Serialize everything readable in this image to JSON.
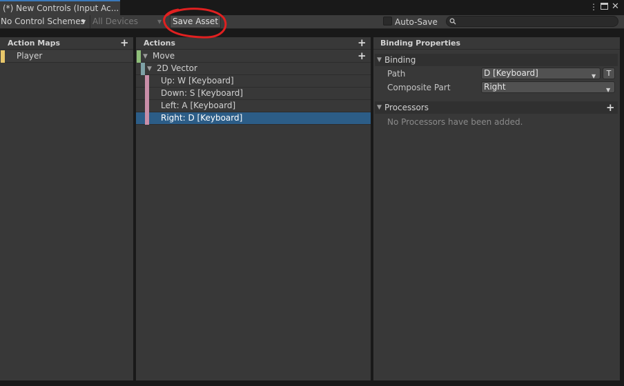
{
  "window": {
    "tab_title": "(*) New Controls (Input Ac...",
    "menu_icon": "kebab-menu-icon",
    "maximize_icon": "maximize-icon",
    "close_icon": "close-icon"
  },
  "toolbar": {
    "control_scheme": "No Control Schemes",
    "devices": "All Devices",
    "save_label": "Save Asset",
    "autosave_label": "Auto-Save",
    "autosave_checked": false,
    "search_placeholder": ""
  },
  "action_maps": {
    "header": "Action Maps",
    "items": [
      {
        "label": "Player",
        "color": "#e8c76a"
      }
    ]
  },
  "actions": {
    "header": "Actions",
    "rows": [
      {
        "label": "Move",
        "color": "#8fbf7a",
        "level": 0,
        "expanded": true,
        "selected": false
      },
      {
        "label": "2D Vector",
        "color": "#7ea1a6",
        "level": 1,
        "expanded": true,
        "selected": false
      },
      {
        "label": "Up: W [Keyboard]",
        "color": "#c98ea8",
        "level": 2,
        "selected": false
      },
      {
        "label": "Down: S [Keyboard]",
        "color": "#c98ea8",
        "level": 2,
        "selected": false
      },
      {
        "label": "Left: A [Keyboard]",
        "color": "#c98ea8",
        "level": 2,
        "selected": false
      },
      {
        "label": "Right: D [Keyboard]",
        "color": "#c98ea8",
        "level": 2,
        "selected": true
      }
    ]
  },
  "binding_properties": {
    "header": "Binding Properties",
    "binding_section": "Binding",
    "path_label": "Path",
    "path_value": "D [Keyboard]",
    "t_button": "T",
    "composite_label": "Composite Part",
    "composite_value": "Right",
    "processors_section": "Processors",
    "processors_empty": "No Processors have been added."
  },
  "colors": {
    "accent_tab": "#3a79bb",
    "selection": "#2c5d87",
    "annotation_red": "#e02020"
  }
}
